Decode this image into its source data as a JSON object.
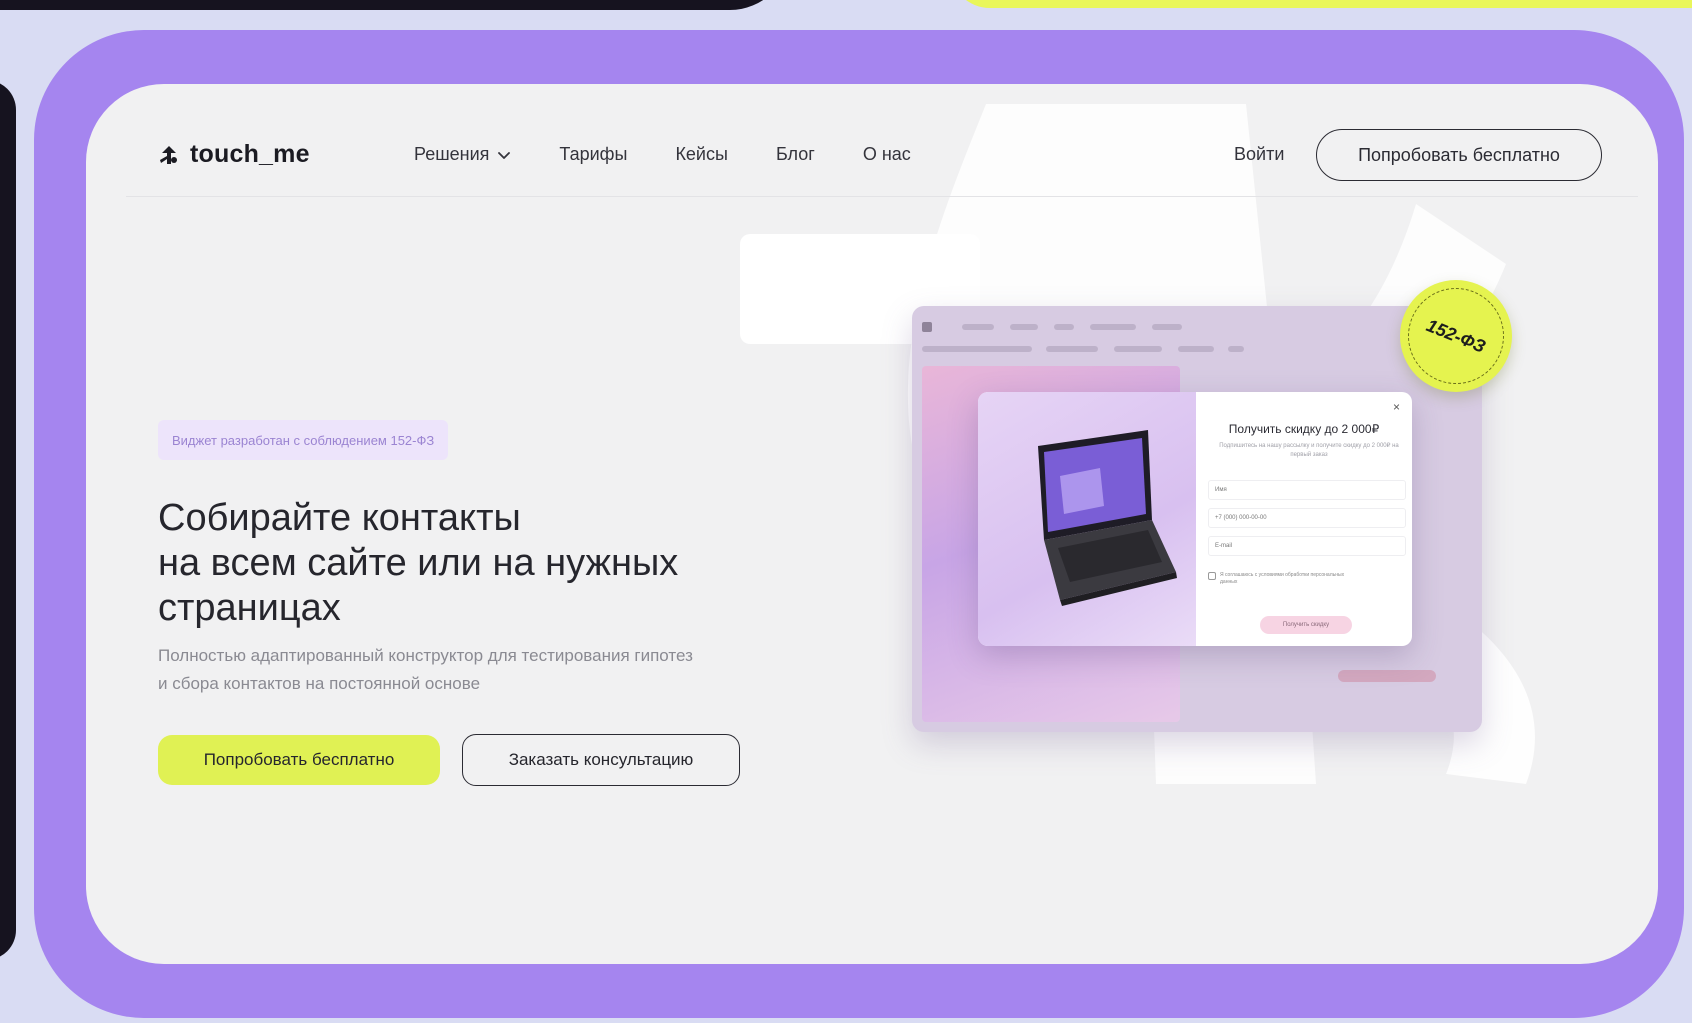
{
  "header": {
    "brand": "touch_me",
    "menu": [
      {
        "label": "Решения",
        "has_dropdown": true
      },
      {
        "label": "Тарифы"
      },
      {
        "label": "Кейсы"
      },
      {
        "label": "Блог"
      },
      {
        "label": "О нас"
      }
    ],
    "login_label": "Войти",
    "cta_label": "Попробовать бесплатно"
  },
  "hero": {
    "badge": "Виджет разработан с соблюдением 152-ФЗ",
    "title_line1": "Собирайте контакты",
    "title_line2": "на всем сайте или на нужных",
    "title_line3": "страницах",
    "subtitle_line1": "Полностью адаптированный конструктор для тестирования гипотез",
    "subtitle_line2": "и сбора контактов на постоянной основе",
    "primary_button": "Попробовать бесплатно",
    "secondary_button": "Заказать консультацию"
  },
  "popup": {
    "close": "×",
    "title": "Получить скидку до 2 000₽",
    "description": "Подпишитесь на нашу рассылку и получите скидку до 2 000₽ на первый заказ",
    "fields": [
      "Имя",
      "+7 (000) 000-00-00",
      "E-mail"
    ],
    "consent": "Я соглашаюсь с условиями обработки персональных данных",
    "button": "Получить скидку"
  },
  "stamp": "152-ФЗ",
  "colors": {
    "accent_lime": "#e0f154",
    "frame_purple": "#a585ef",
    "page_bg": "#f1f1f2",
    "text_dark": "#26262d"
  }
}
